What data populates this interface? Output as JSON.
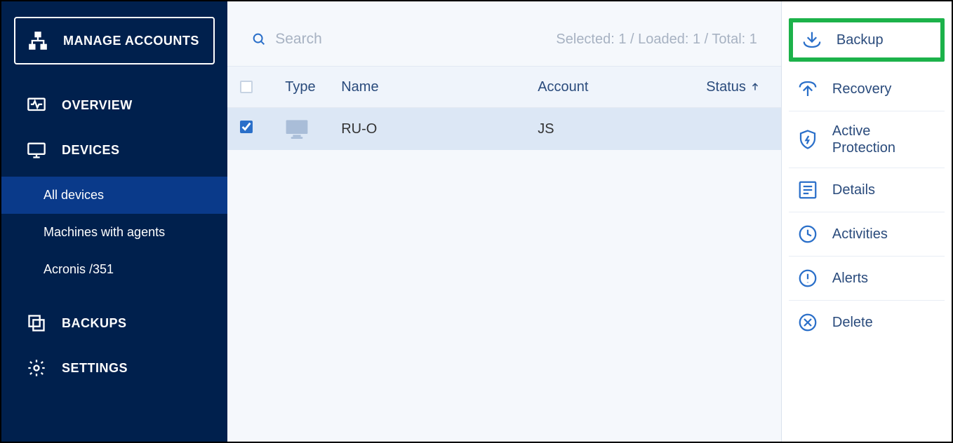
{
  "sidebar": {
    "manage_accounts": "MANAGE ACCOUNTS",
    "overview": "OVERVIEW",
    "devices": "DEVICES",
    "submenu": {
      "all_devices": "All devices",
      "machines_with_agents": "Machines with agents",
      "acronis_351": "Acronis /351"
    },
    "backups": "BACKUPS",
    "settings": "SETTINGS"
  },
  "toolbar": {
    "search_placeholder": "Search",
    "status": "Selected: 1 / Loaded: 1 / Total: 1"
  },
  "table": {
    "headers": {
      "type": "Type",
      "name": "Name",
      "account": "Account",
      "status": "Status"
    },
    "rows": [
      {
        "checked": true,
        "type": "desktop",
        "name": "RU-O",
        "account": "JS",
        "status": ""
      }
    ]
  },
  "actions": {
    "backup": "Backup",
    "recovery": "Recovery",
    "active_protection_l1": "Active",
    "active_protection_l2": "Protection",
    "details": "Details",
    "activities": "Activities",
    "alerts": "Alerts",
    "delete": "Delete"
  }
}
